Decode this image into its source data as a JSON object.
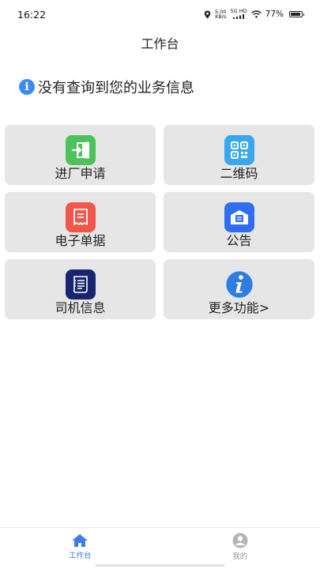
{
  "status_bar": {
    "time": "16:22",
    "net_speed_value": "5.00",
    "net_speed_unit": "KB/s",
    "network": "5G HD",
    "battery": "77%"
  },
  "header": {
    "title": "工作台"
  },
  "notice": {
    "text": "没有查询到您的业务信息",
    "icon": "info-icon",
    "icon_glyph": "i"
  },
  "tiles": [
    {
      "label": "进厂申请",
      "icon": "enter-factory-icon",
      "color": "#4cc35a"
    },
    {
      "label": "二维码",
      "icon": "qr-code-icon",
      "color": "#3aa8f0"
    },
    {
      "label": "电子单据",
      "icon": "receipt-icon",
      "color": "#f0574a"
    },
    {
      "label": "公告",
      "icon": "announcement-icon",
      "color": "#2f6ef0"
    },
    {
      "label": "司机信息",
      "icon": "driver-info-icon",
      "color": "#1a2570"
    },
    {
      "label": "更多功能>",
      "icon": "more-info-icon",
      "color": "#2f7de0"
    }
  ],
  "bottom_nav": [
    {
      "label": "工作台",
      "icon": "home-icon",
      "active": true
    },
    {
      "label": "我的",
      "icon": "profile-icon",
      "active": false
    }
  ]
}
